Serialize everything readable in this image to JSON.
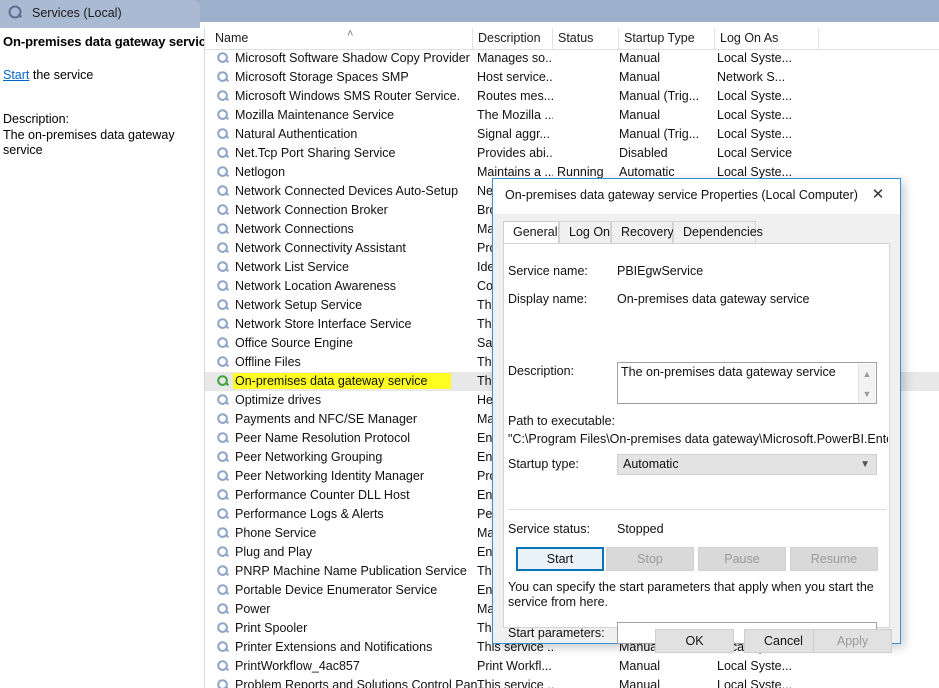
{
  "window": {
    "tab_title": "Services (Local)",
    "app_icon": "services-gear-icon"
  },
  "left_pane": {
    "heading": "On-premises data gateway service",
    "action_link": "Start",
    "action_suffix": " the service",
    "description_label": "Description:",
    "description_text": "The on-premises data gateway service"
  },
  "list": {
    "columns": [
      {
        "label": "Name",
        "sort_indicator": "˄"
      },
      {
        "label": "Description"
      },
      {
        "label": "Status"
      },
      {
        "label": "Startup Type"
      },
      {
        "label": "Log On As"
      }
    ],
    "rows": [
      {
        "name": "Microsoft Software Shadow Copy Provider",
        "description": "Manages so...",
        "status": "",
        "startup": "Manual",
        "logon": "Local Syste..."
      },
      {
        "name": "Microsoft Storage Spaces SMP",
        "description": "Host service...",
        "status": "",
        "startup": "Manual",
        "logon": "Network S..."
      },
      {
        "name": "Microsoft Windows SMS Router Service.",
        "description": "Routes mes...",
        "status": "",
        "startup": "Manual (Trig...",
        "logon": "Local Syste..."
      },
      {
        "name": "Mozilla Maintenance Service",
        "description": "The Mozilla ...",
        "status": "",
        "startup": "Manual",
        "logon": "Local Syste..."
      },
      {
        "name": "Natural Authentication",
        "description": "Signal aggr...",
        "status": "",
        "startup": "Manual (Trig...",
        "logon": "Local Syste..."
      },
      {
        "name": "Net.Tcp Port Sharing Service",
        "description": "Provides abi...",
        "status": "",
        "startup": "Disabled",
        "logon": "Local Service"
      },
      {
        "name": "Netlogon",
        "description": "Maintains a ...",
        "status": "Running",
        "startup": "Automatic",
        "logon": "Local Syste..."
      },
      {
        "name": "Network Connected Devices Auto-Setup",
        "description": "Ne",
        "status": "",
        "startup": "",
        "logon": ""
      },
      {
        "name": "Network Connection Broker",
        "description": "Bro",
        "status": "",
        "startup": "",
        "logon": ""
      },
      {
        "name": "Network Connections",
        "description": "Ma",
        "status": "",
        "startup": "",
        "logon": ""
      },
      {
        "name": "Network Connectivity Assistant",
        "description": "Pro",
        "status": "",
        "startup": "",
        "logon": ""
      },
      {
        "name": "Network List Service",
        "description": "Ide",
        "status": "",
        "startup": "",
        "logon": ""
      },
      {
        "name": "Network Location Awareness",
        "description": "Co",
        "status": "",
        "startup": "",
        "logon": ""
      },
      {
        "name": "Network Setup Service",
        "description": "Th",
        "status": "",
        "startup": "",
        "logon": ""
      },
      {
        "name": "Network Store Interface Service",
        "description": "Th",
        "status": "",
        "startup": "",
        "logon": ""
      },
      {
        "name": "Office  Source Engine",
        "description": "Sav",
        "status": "",
        "startup": "",
        "logon": ""
      },
      {
        "name": "Offline Files",
        "description": "Th",
        "status": "",
        "startup": "",
        "logon": ""
      },
      {
        "name": "On-premises data gateway service",
        "description": "Th",
        "status": "",
        "startup": "",
        "logon": "",
        "selected": true,
        "highlighted": true
      },
      {
        "name": "Optimize drives",
        "description": "He",
        "status": "",
        "startup": "",
        "logon": ""
      },
      {
        "name": "Payments and NFC/SE Manager",
        "description": "Ma",
        "status": "",
        "startup": "",
        "logon": ""
      },
      {
        "name": "Peer Name Resolution Protocol",
        "description": "En",
        "status": "",
        "startup": "",
        "logon": ""
      },
      {
        "name": "Peer Networking Grouping",
        "description": "En",
        "status": "",
        "startup": "",
        "logon": ""
      },
      {
        "name": "Peer Networking Identity Manager",
        "description": "Pro",
        "status": "",
        "startup": "",
        "logon": ""
      },
      {
        "name": "Performance Counter DLL Host",
        "description": "En",
        "status": "",
        "startup": "",
        "logon": ""
      },
      {
        "name": "Performance Logs & Alerts",
        "description": "Pe",
        "status": "",
        "startup": "",
        "logon": ""
      },
      {
        "name": "Phone Service",
        "description": "Ma",
        "status": "",
        "startup": "",
        "logon": ""
      },
      {
        "name": "Plug and Play",
        "description": "En",
        "status": "",
        "startup": "",
        "logon": ""
      },
      {
        "name": "PNRP Machine Name Publication Service",
        "description": "Th",
        "status": "",
        "startup": "",
        "logon": ""
      },
      {
        "name": "Portable Device Enumerator Service",
        "description": "En",
        "status": "",
        "startup": "",
        "logon": ""
      },
      {
        "name": "Power",
        "description": "Ma",
        "status": "",
        "startup": "",
        "logon": ""
      },
      {
        "name": "Print Spooler",
        "description": "Th",
        "status": "",
        "startup": "",
        "logon": ""
      },
      {
        "name": "Printer Extensions and Notifications",
        "description": "This service ...",
        "status": "",
        "startup": "Manual",
        "logon": "Local Syste..."
      },
      {
        "name": "PrintWorkflow_4ac857",
        "description": "Print Workfl...",
        "status": "",
        "startup": "Manual",
        "logon": "Local Syste..."
      },
      {
        "name": "Problem Reports and Solutions Control Pan...",
        "description": "This service ...",
        "status": "",
        "startup": "Manual",
        "logon": "Local Syste..."
      }
    ]
  },
  "dialog": {
    "title": "On-premises data gateway service Properties (Local Computer)",
    "close_label": "✕",
    "tabs": [
      {
        "label": "General",
        "active": true
      },
      {
        "label": "Log On",
        "active": false
      },
      {
        "label": "Recovery",
        "active": false
      },
      {
        "label": "Dependencies",
        "active": false
      }
    ],
    "fields": {
      "service_name_label": "Service name:",
      "service_name_value": "PBIEgwService",
      "display_name_label": "Display name:",
      "display_name_value": "On-premises data gateway service",
      "description_label": "Description:",
      "description_value": "The on-premises data gateway service",
      "path_label": "Path to executable:",
      "path_value": "\"C:\\Program Files\\On-premises data gateway\\Microsoft.PowerBI.EnterpriseG",
      "startup_type_label": "Startup type:",
      "startup_type_value": "Automatic",
      "service_status_label": "Service status:",
      "service_status_value": "Stopped",
      "start_params_label": "Start parameters:",
      "start_params_value": "",
      "hint_text": "You can specify the start parameters that apply when you start the service from here."
    },
    "control_buttons": [
      {
        "label": "Start",
        "state": "focused"
      },
      {
        "label": "Stop",
        "state": "disabled"
      },
      {
        "label": "Pause",
        "state": "disabled"
      },
      {
        "label": "Resume",
        "state": "disabled"
      }
    ],
    "footer_buttons": [
      {
        "label": "OK",
        "state": "enabled"
      },
      {
        "label": "Cancel",
        "state": "enabled"
      },
      {
        "label": "Apply",
        "state": "disabled"
      }
    ]
  },
  "colors": {
    "titlebar": "#9db0cb",
    "panel_tab": "#a9bad2",
    "highlight": "#fdfd22",
    "dialog_border": "#3a8fd0",
    "focus_button": "#0a73b8",
    "link": "#0066cc"
  }
}
